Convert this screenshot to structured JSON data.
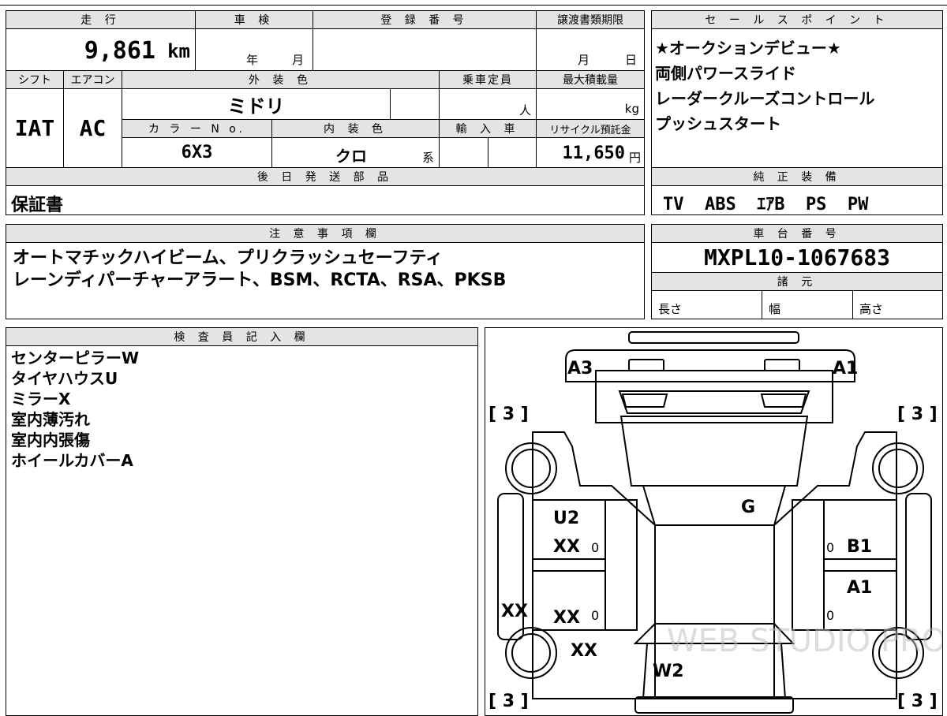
{
  "vehicle": {
    "mileage_label": "走 行",
    "mileage_value": "9,861",
    "mileage_unit": "km",
    "inspection_label": "車 検",
    "inspection_year": "年",
    "inspection_month": "月",
    "registration_label": "登 録 番 号",
    "transfer_label": "譲渡書類期限",
    "transfer_month": "月",
    "transfer_day": "日",
    "shift_label": "シフト",
    "shift_value": "IAT",
    "ac_label": "エアコン",
    "ac_value": "AC",
    "exterior_label": "外 装 色",
    "exterior_value": "ミドリ",
    "capacity_label": "乗車定員",
    "capacity_unit": "人",
    "load_label": "最大積載量",
    "load_unit": "kg",
    "color_no_label": "カ ラ ー N o.",
    "color_no_value": "6X3",
    "interior_label": "内 装 色",
    "interior_value": "クロ",
    "interior_suffix": "系",
    "import_label": "輸 入 車",
    "recycle_label": "リサイクル預託金",
    "recycle_value": "11,650",
    "recycle_unit": "円",
    "later_parts_label": "後 日 発 送 部 品",
    "later_parts_value": "保証書"
  },
  "sales": {
    "label": "セ ー ル ス ポ イ ン ト",
    "points": [
      "★オークションデビュー★",
      "両側パワースライド",
      "レーダークルーズコントロール",
      "プッシュスタート"
    ]
  },
  "equipment": {
    "label": "純 正 装 備",
    "value": "TV  ABS  ｴｱB  PS  PW"
  },
  "notes": {
    "label": "注 意 事 項 欄",
    "lines": [
      "オートマチックハイビーム、プリクラッシュセーフティ",
      "レーンディパーチャーアラート、BSM、RCTA、RSA、PKSB"
    ]
  },
  "chassis": {
    "label": "車 台 番 号",
    "value": "MXPL10-1067683",
    "specs_label": "諸 元",
    "length_label": "長さ",
    "width_label": "幅",
    "height_label": "高さ"
  },
  "inspector": {
    "label": "検 査 員 記 入 欄",
    "lines": [
      "センターピラーW",
      "タイヤハウスU",
      "ミラーX",
      "室内薄汚れ",
      "室内内張傷",
      "ホイールカバーA"
    ]
  },
  "diagram": {
    "marks": {
      "a3": "A3",
      "a1_top": "A1",
      "u2": "U2",
      "xx_fl": "XX",
      "xx_rl": "XX",
      "xx_left": "XX",
      "xx_rear": "XX",
      "g": "G",
      "b1": "B1",
      "a1_right": "A1",
      "w2": "W2",
      "zero": "0",
      "tire_tl": "[ 3 ]",
      "tire_tr": "[ 3 ]",
      "tire_bl": "[ 3 ]",
      "tire_br": "[ 3 ]"
    },
    "watermark": "WEB STUDIO PRO"
  }
}
